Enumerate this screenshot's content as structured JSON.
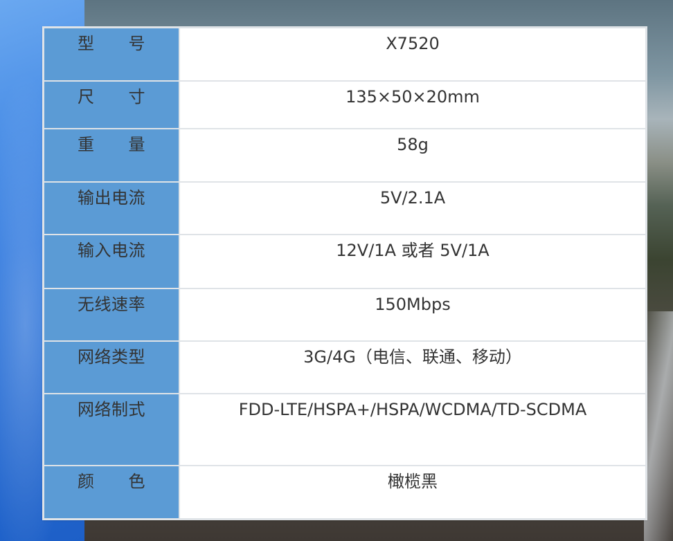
{
  "spec_table": {
    "rows": [
      {
        "label": "型　　号",
        "value": "X7520"
      },
      {
        "label": "尺　　寸",
        "value": "135×50×20mm"
      },
      {
        "label": "重　　量",
        "value": "58g"
      },
      {
        "label": "输出电流",
        "value": "5V/2.1A"
      },
      {
        "label": "输入电流",
        "value": "12V/1A 或者 5V/1A"
      },
      {
        "label": "无线速率",
        "value": "150Mbps"
      },
      {
        "label": "网络类型",
        "value": "3G/4G（电信、联通、移动）"
      },
      {
        "label": "网络制式",
        "value": "FDD-LTE/HSPA+/HSPA/WCDMA/TD-SCDMA"
      },
      {
        "label": "颜　　色",
        "value": "橄榄黑"
      }
    ]
  },
  "colors": {
    "label_bg": "#5b9bd5",
    "value_bg": "#ffffff",
    "border": "#dfe3e7",
    "text": "#333333"
  }
}
